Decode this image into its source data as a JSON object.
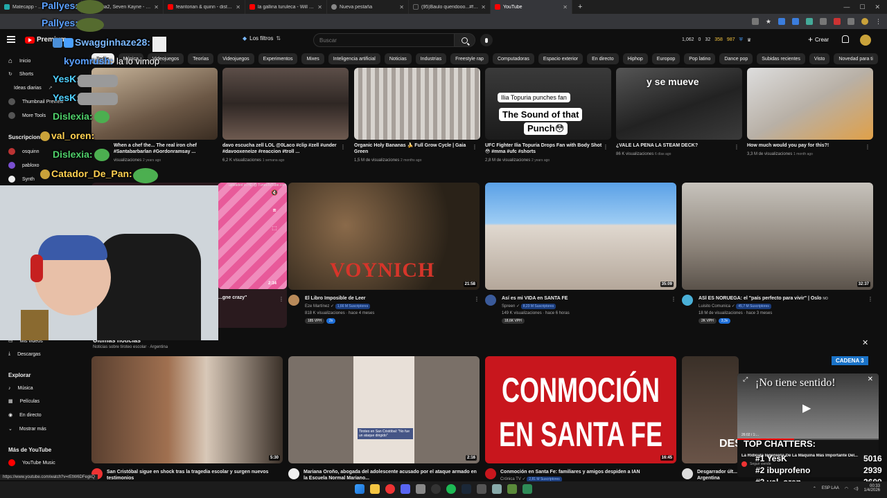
{
  "tabs": [
    {
      "title": "Matecapp - ...",
      "color": "#2aa"
    },
    {
      "title": "Skisia2, Seven Kayne - 123...",
      "color": "#f40"
    },
    {
      "title": "feantorian & quinn - distance ...",
      "color": "#f00"
    },
    {
      "title": "la gallina turuleca - Will y Rex...",
      "color": "#f00"
    },
    {
      "title": "Nueva pestaña",
      "color": "#888"
    },
    {
      "title": "(95)Baulo queridooo...#fyyp #...",
      "color": "#222"
    },
    {
      "title": "YouTube",
      "color": "#f00"
    }
  ],
  "masthead": {
    "logo": "Premium",
    "filters": "Los filtros",
    "search_placeholder": "Buscar",
    "stats": [
      "1,062",
      "0",
      "32",
      "358",
      "987"
    ],
    "create": "Crear"
  },
  "chips": [
    "Todos",
    "Música",
    "Videojuegos",
    "Teorías",
    "Videojuegos",
    "Experimentos",
    "Mixes",
    "Inteligencia artificial",
    "Noticias",
    "Industrias",
    "Freestyle rap",
    "Computadoras",
    "Espacio exterior",
    "En directo",
    "Hiphop",
    "Europop",
    "Pop latino",
    "Dance pop",
    "Subidas recientes",
    "Visto",
    "Novedad para ti"
  ],
  "guide": {
    "top": [
      "Inicio",
      "Shorts",
      "Ideas diarias",
      "Thumbnail Preview",
      "More Tools"
    ],
    "subs_header": "Suscripciones",
    "subs": [
      "osquinn",
      "pabloxo",
      "Synth"
    ],
    "mid": [
      "Mis videos",
      "Descargas"
    ],
    "explore_header": "Explorar",
    "explore": [
      "Música",
      "Películas",
      "En directo",
      "Mostrar más"
    ],
    "more_header": "Más de YouTube",
    "more": [
      "YouTube Music"
    ]
  },
  "row1": [
    {
      "title": "When a chef the... The real iron chef #Santabarbarlan #Gordonramsay ...",
      "meta": "visualizaciones",
      "ago": "2 years ago"
    },
    {
      "title": "davo escucha zell LOL @0Laco #clip #zell #under #davooxeneize #reaccion #troll ...",
      "meta": "6,2 K visualizaciones",
      "ago": "1 semana ago"
    },
    {
      "title": "Organic Holy Bananas 🍌 Full Grow Cycle | Gaia Green",
      "meta": "1,5 M de visualizaciones",
      "ago": "2 months ago"
    },
    {
      "title": "UFC Fighter Ilia Topuria Drops Fan with Body Shot😳 #mma #ufc #shorts",
      "meta": "2,8 M de visualizaciones",
      "ago": "2 years ago",
      "thumb_text1": "Ilia Topuria punches fan",
      "thumb_text2": "The Sound of that",
      "thumb_text3": "Punch😳"
    },
    {
      "title": "¿VALE LA PENA LA STEAM DECK?",
      "meta": "86 K visualizaciones",
      "ago": "6 días ago",
      "thumb_text1": "y se mueve"
    },
    {
      "title": "How much would you pay for this?!",
      "meta": "3,3 M de visualizaciones",
      "ago": "1 month ago"
    }
  ],
  "row2": [
    {
      "title": "...gne crazy\"",
      "dur": "2:34",
      "uploaded": "uploaded in HD @ TunesToTube.com"
    },
    {
      "title": "El Libro Imposible de Leer",
      "channel": "Eze Martínez",
      "subs": "1,66 M Suscriptores",
      "meta": "818 K visualizaciones · hace 4 meses",
      "vph": "185 VPH",
      "badge": "2x",
      "dur": "21:58",
      "thumb_text": "VOYNICH"
    },
    {
      "title": "Así es mi VIDA en SANTA FE",
      "channel": "Spreen",
      "subs": "8,23 M Suscriptores",
      "meta": "149 K visualizaciones · hace 6 horas",
      "vph": "18,6K VPH",
      "badge": "",
      "dur": "35:09"
    },
    {
      "title": "ASÍ ES NORUEGA: el \"país perfecto para vivir\" | Oslo",
      "title_tag": "NO",
      "channel": "Luisito Comunica",
      "subs": "45,7 M Suscriptores",
      "meta": "18 M de visualizaciones · hace 3 meses",
      "vph": "2K VPH",
      "badge": "3,3x",
      "dur": "32:37"
    }
  ],
  "news": {
    "header": "Últimas noticias",
    "sub": "Noticias sobre tiroteo escolar · Argentina",
    "close": "✕",
    "items": [
      {
        "title": "San Cristóbal sigue en shock tras la tragedia escolar y surgen nuevos testimonios",
        "dur": "5:30"
      },
      {
        "title": "Mariana Oroño, abogada del adolescente acusado por el ataque armado en la Escuela Normal Mariano...",
        "dur": "2:16",
        "thumb_caption": "Tiroteo en San Cristóbal: \"No fue un ataque dirigido\""
      },
      {
        "title": "Conmoción en Santa Fe: familiares y amigos despiden a IAN",
        "channel": "Crónica TV",
        "subs": "2,81 M Suscriptores",
        "dur": "16:45",
        "thumb_text1": "CONMOCIÓN",
        "thumb_text2": "EN SANTA FE"
      },
      {
        "title": "Desgarrador últ... Argentina",
        "thumb_text": "DES",
        "cadena": "CADENA 3"
      }
    ]
  },
  "mini": {
    "header": "¡No tiene sentido!",
    "time": "26:02 / 1:...",
    "title": "La Ridícula Ingeniería De La Máquina Más Importante Del...",
    "sub": "Seguir viendo"
  },
  "chat": [
    {
      "name": "Pallyes:",
      "color": "#5aa0ff"
    },
    {
      "name": "Pallyes:",
      "color": "#5aa0ff"
    },
    {
      "name": "Swagginhaze28:",
      "color": "#7ab8ff"
    },
    {
      "name": "kyomrush:",
      "color": "#5aa0ff",
      "msg": "la lo vimop"
    },
    {
      "name": "YesK:",
      "color": "#4fd0ff"
    },
    {
      "name": "YesK:",
      "color": "#4fd0ff"
    },
    {
      "name": "Dislexia:",
      "color": "#4fd06a"
    },
    {
      "name": "val_oren:",
      "color": "#ffd050"
    },
    {
      "name": "Dislexia:",
      "color": "#4fd06a"
    },
    {
      "name": "Catador_De_Pan:",
      "color": "#ffd050"
    }
  ],
  "top_chatters": {
    "header": "TOP CHATTERS:",
    "rows": [
      {
        "rank": "#1 YesK",
        "count": "5016"
      },
      {
        "rank": "#2 ibuprofeno",
        "count": "2939"
      },
      {
        "rank": "#3 val_oren",
        "count": "2609"
      }
    ]
  },
  "status_url": "https://www.youtube.com/watch?v=rEtW6DFegkQ",
  "tray": {
    "lang": "ESP LAA",
    "time": "00:33",
    "date": "1/4/2026"
  }
}
